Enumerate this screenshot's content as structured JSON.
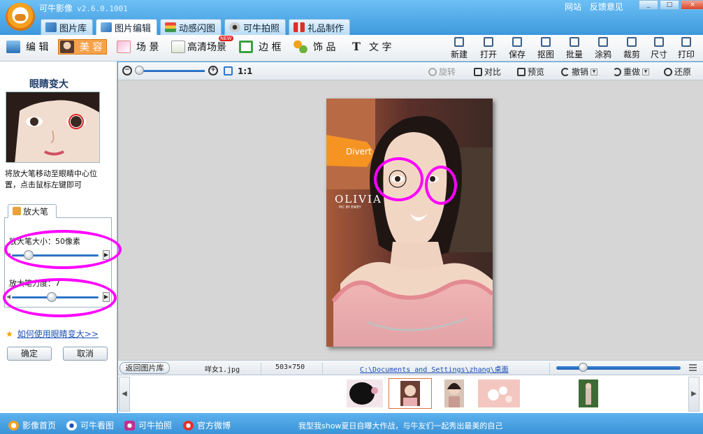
{
  "window": {
    "app_title": "可牛影像",
    "version": "v2.6.0.1001",
    "links": [
      "网站",
      "反馈意见"
    ],
    "controls": [
      "_",
      "□",
      "×"
    ]
  },
  "main_tabs": [
    {
      "label": "图片库",
      "icon": "gallery-icon",
      "active": false
    },
    {
      "label": "图片编辑",
      "icon": "edit-image-icon",
      "active": true
    },
    {
      "label": "动感闪图",
      "icon": "animation-icon",
      "active": false
    },
    {
      "label": "可牛拍照",
      "icon": "webcam-icon",
      "active": false
    },
    {
      "label": "礼品制作",
      "icon": "gift-icon",
      "active": false
    }
  ],
  "toolbar": {
    "left_tools": [
      {
        "label": "编 辑",
        "icon": "edit-icon"
      },
      {
        "label": "美 容",
        "icon": "beauty-icon",
        "active": true
      },
      {
        "label": "场 景",
        "icon": "scene-icon"
      },
      {
        "label": "高清场景",
        "icon": "hd-scene-icon"
      },
      {
        "label": "边 框",
        "icon": "frame-icon"
      },
      {
        "label": "饰 品",
        "icon": "accessory-icon"
      },
      {
        "label": "文 字",
        "icon": "text-icon"
      }
    ],
    "new_badge": "NEW",
    "right_tools": [
      {
        "label": "新建",
        "icon": "new-file-icon"
      },
      {
        "label": "打开",
        "icon": "open-folder-icon"
      },
      {
        "label": "保存",
        "icon": "save-icon"
      },
      {
        "label": "抠图",
        "icon": "cutout-icon"
      },
      {
        "label": "批量",
        "icon": "batch-icon"
      },
      {
        "label": "涂鸦",
        "icon": "doodle-icon"
      },
      {
        "label": "裁剪",
        "icon": "crop-icon"
      },
      {
        "label": "尺寸",
        "icon": "resize-icon"
      },
      {
        "label": "打印",
        "icon": "print-icon"
      }
    ]
  },
  "left_panel": {
    "title": "眼睛变大",
    "instruction": "将放大笔移动至眼睛中心位置，点击鼠标左键即可",
    "subtab": "放大笔",
    "size_label": "放大笔大小：50像素",
    "size_value": 0.15,
    "strength_label": "放大笔力度：7",
    "strength_value": 0.45,
    "help_link": "如何使用眼睛变大>>",
    "confirm": "确定",
    "cancel": "取消"
  },
  "canvas_toolbar": {
    "ratio": "1:1",
    "zoom_value": 0.0,
    "rotate": "旋转",
    "compare": "对比",
    "preview": "预览",
    "undo": "撤销",
    "redo": "重做",
    "restore": "还原"
  },
  "photo": {
    "overlay_text": "OLIVIA",
    "overlay_sub": "PIC BY EWEY",
    "sign_text": "Divert"
  },
  "status": {
    "back": "返回图片库",
    "filename": "咩女1.jpg",
    "dimensions": "503×750",
    "path": "C:\\Documents and Settings\\zhang\\桌面"
  },
  "filmstrip": {
    "thumbs": [
      "thumb-1",
      "thumb-2",
      "thumb-3",
      "thumb-4",
      "thumb-5"
    ]
  },
  "bottom_bar": {
    "links": [
      {
        "label": "影像首页",
        "icon": "home-cow-icon"
      },
      {
        "label": "可牛看图",
        "icon": "eye-icon"
      },
      {
        "label": "可牛拍照",
        "icon": "camera-icon"
      },
      {
        "label": "官方微博",
        "icon": "weibo-icon"
      }
    ],
    "message": "我型我show夏日自曝大作战，与牛友们一起秀出最美的自己"
  },
  "colors": {
    "accent": "#4aa3e6",
    "highlight": "#f6a24a",
    "annotation": "#ff00ff"
  }
}
